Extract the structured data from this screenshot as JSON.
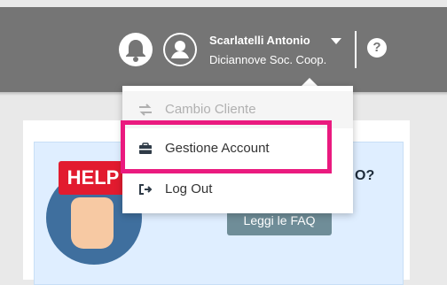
{
  "header": {
    "user_name": "Scarlatelli Antonio",
    "company": "Diciannove Soc. Coop.",
    "help_symbol": "?"
  },
  "menu": {
    "items": [
      {
        "label": "Cambio Cliente",
        "icon": "swap-arrows-icon",
        "disabled": true
      },
      {
        "label": "Gestione Account",
        "icon": "briefcase-icon",
        "highlighted": true
      },
      {
        "label": "Log Out",
        "icon": "sign-out-icon"
      }
    ]
  },
  "help_panel": {
    "sign_text": "HELP",
    "title_partial": "O?",
    "faq_button": "Leggi le FAQ"
  },
  "colors": {
    "header": "#757575",
    "highlight": "#ea1a7f",
    "help_sign": "#e21b2f",
    "faq_button": "#6f8d98"
  }
}
